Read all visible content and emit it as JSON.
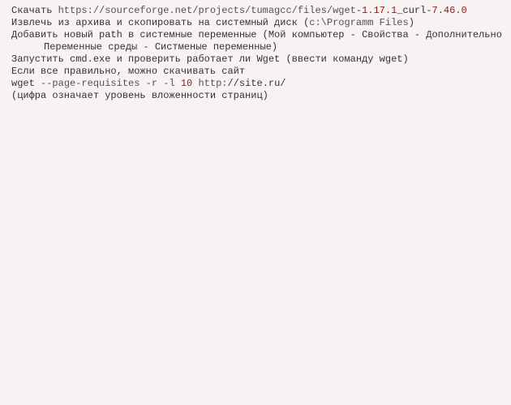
{
  "lines": {
    "l1": {
      "pre": "Скачать ",
      "url": "https://sourceforge.net/projects/tumagcc/files/wget",
      "dash1": "-",
      "v1": "1.17.1",
      "mid": "_curl",
      "dash2": "-",
      "v2": "7.46.0"
    },
    "l2": {
      "pre": "Извлечь из архива и скопировать на системный диск ",
      "paren_open": "(",
      "path": "c:\\Programm Files",
      "paren_close": ")"
    },
    "l3": "Добавить новый path в системные переменные (Мой компьютер - Свойства - Дополнительно",
    "l4": "Переменные среды - Систменые переменные)",
    "l5": "Запустить cmd.exe и проверить работает ли Wget (ввести команду wget)",
    "l6": "Если все правильно, можно скачивать сайт",
    "l7": {
      "cmd": "wget ",
      "flag1": "--page-requisites",
      "sp1": " ",
      "flag2": "-r",
      "sp2": " ",
      "flag3": "-l",
      "sp3": " ",
      "num": "10",
      "sp4": " ",
      "proto": "http:",
      "rest": "//site.ru/"
    },
    "l8": "(цифра означает уровень вложенности страниц)"
  }
}
